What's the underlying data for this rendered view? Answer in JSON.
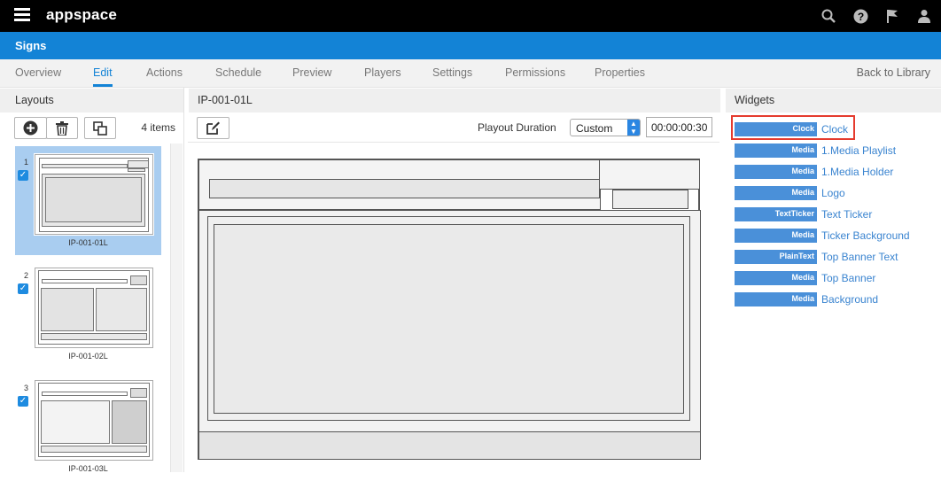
{
  "app": {
    "name": "appspace",
    "section": "Signs"
  },
  "top_icons": [
    "search-icon",
    "help-icon",
    "flag-icon",
    "user-icon"
  ],
  "tabs": [
    {
      "label": "Overview",
      "active": false
    },
    {
      "label": "Edit",
      "active": true
    },
    {
      "label": "Actions",
      "active": false
    },
    {
      "label": "Schedule",
      "active": false
    },
    {
      "label": "Preview",
      "active": false
    },
    {
      "label": "Players",
      "active": false
    },
    {
      "label": "Settings",
      "active": false
    },
    {
      "label": "Permissions",
      "active": false
    },
    {
      "label": "Properties",
      "active": false
    }
  ],
  "back_label": "Back to Library",
  "layouts": {
    "title": "Layouts",
    "count": "4 items",
    "items": [
      {
        "num": "1",
        "name": "IP-001-01L",
        "selected": true,
        "checked": true
      },
      {
        "num": "2",
        "name": "IP-001-02L",
        "selected": false,
        "checked": true
      },
      {
        "num": "3",
        "name": "IP-001-03L",
        "selected": false,
        "checked": true
      }
    ]
  },
  "editor": {
    "title": "IP-001-01L",
    "playout_label": "Playout Duration",
    "playout_mode": "Custom",
    "duration": "00:00:00:30"
  },
  "widgets": {
    "title": "Widgets",
    "items": [
      {
        "type": "Clock",
        "name": "Clock"
      },
      {
        "type": "Media",
        "name": "1.Media Playlist"
      },
      {
        "type": "Media",
        "name": "1.Media Holder"
      },
      {
        "type": "Media",
        "name": "Logo"
      },
      {
        "type": "TextTicker",
        "name": "Text Ticker"
      },
      {
        "type": "Media",
        "name": "Ticker Background"
      },
      {
        "type": "PlainText",
        "name": "Top Banner Text"
      },
      {
        "type": "Media",
        "name": "Top Banner"
      },
      {
        "type": "Media",
        "name": "Background"
      }
    ]
  },
  "colors": {
    "accent": "#1383d6",
    "highlight": "#e53b2e",
    "widget_tag": "#4a90d9",
    "selected_bg": "#a9cdf0"
  }
}
